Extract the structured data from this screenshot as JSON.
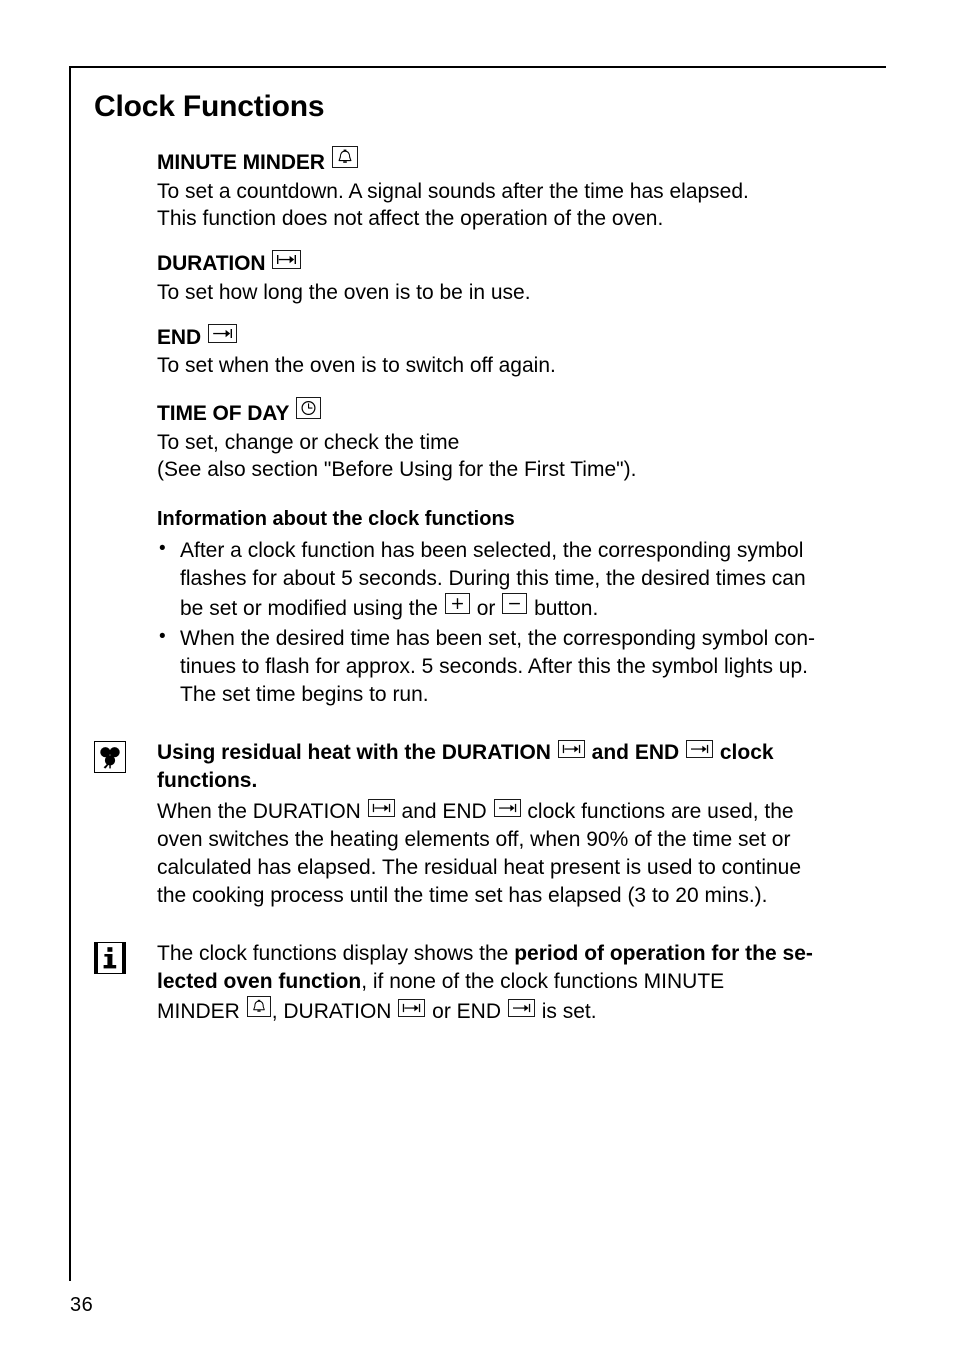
{
  "page": {
    "number": "36",
    "title": "Clock Functions"
  },
  "sections": [
    {
      "id": "minute-minder",
      "heading": "MINUTE MINDER",
      "icon": "bell-icon",
      "lines": [
        "To set a countdown. A signal sounds after the time has elapsed.",
        "This function does not affect the operation of the oven."
      ]
    },
    {
      "id": "duration",
      "heading": "DURATION",
      "icon": "duration-icon",
      "lines": [
        "To set how long the oven is to be in use."
      ]
    },
    {
      "id": "end",
      "heading": "END",
      "icon": "end-icon",
      "lines": [
        "To set when the oven is to switch off again."
      ]
    },
    {
      "id": "time-of-day",
      "heading": "TIME OF DAY",
      "icon": "clock-icon",
      "lines": [
        "To set, change or check the time",
        "(See also section \"Before Using for the First Time\")."
      ]
    }
  ],
  "information": {
    "heading": "Information about the clock functions",
    "bullets": [
      {
        "id": "bullet-symbol-flashes",
        "lines": [
          "After a clock function has been selected, the corresponding symbol",
          "flashes for about 5 seconds. During this time, the desired times can",
          "be set or modified using the"
        ],
        "tail_mid": "or",
        "tail_end": "button."
      },
      {
        "id": "bullet-time-set",
        "lines": [
          "When the desired time has been set, the corresponding symbol con-",
          "tinues to flash for approx. 5 seconds. After this the symbol lights up.",
          "The set time begins to run."
        ]
      }
    ]
  },
  "residual_heat_note": {
    "icon": "shamrock-icon",
    "title_part1": "Using residual heat with the DURATION",
    "title_part2": "and END",
    "title_part3": "clock",
    "title_line2": "functions.",
    "para_a1": "When the DURATION",
    "para_a2": "and END",
    "para_a3": "clock functions are used, the",
    "para_lines": [
      "oven switches the heating elements off, when 90% of the time set or",
      "calculated has elapsed. The residual heat present is used to continue",
      "the cooking process until the time set has elapsed (3 to 20 mins.)."
    ]
  },
  "display_note": {
    "icon": "info-icon",
    "line1_a": "The clock functions display shows the",
    "line1_bold": "period of operation for the se-",
    "line2_bold": "lected oven function",
    "line2_rest": ", if none of the clock functions MINUTE",
    "line3_a": "MINDER",
    "line3_b": ", DURATION",
    "line3_c": "or END",
    "line3_d": "is set."
  },
  "icons": {
    "bell": "bell-icon",
    "duration": "duration-icon",
    "end": "end-icon",
    "clock": "clock-icon",
    "plus": "plus-button-icon",
    "minus": "minus-button-icon",
    "shamrock": "shamrock-icon",
    "info": "info-icon"
  },
  "colors": {
    "text": "#000000",
    "background": "#ffffff",
    "rule": "#000000"
  }
}
